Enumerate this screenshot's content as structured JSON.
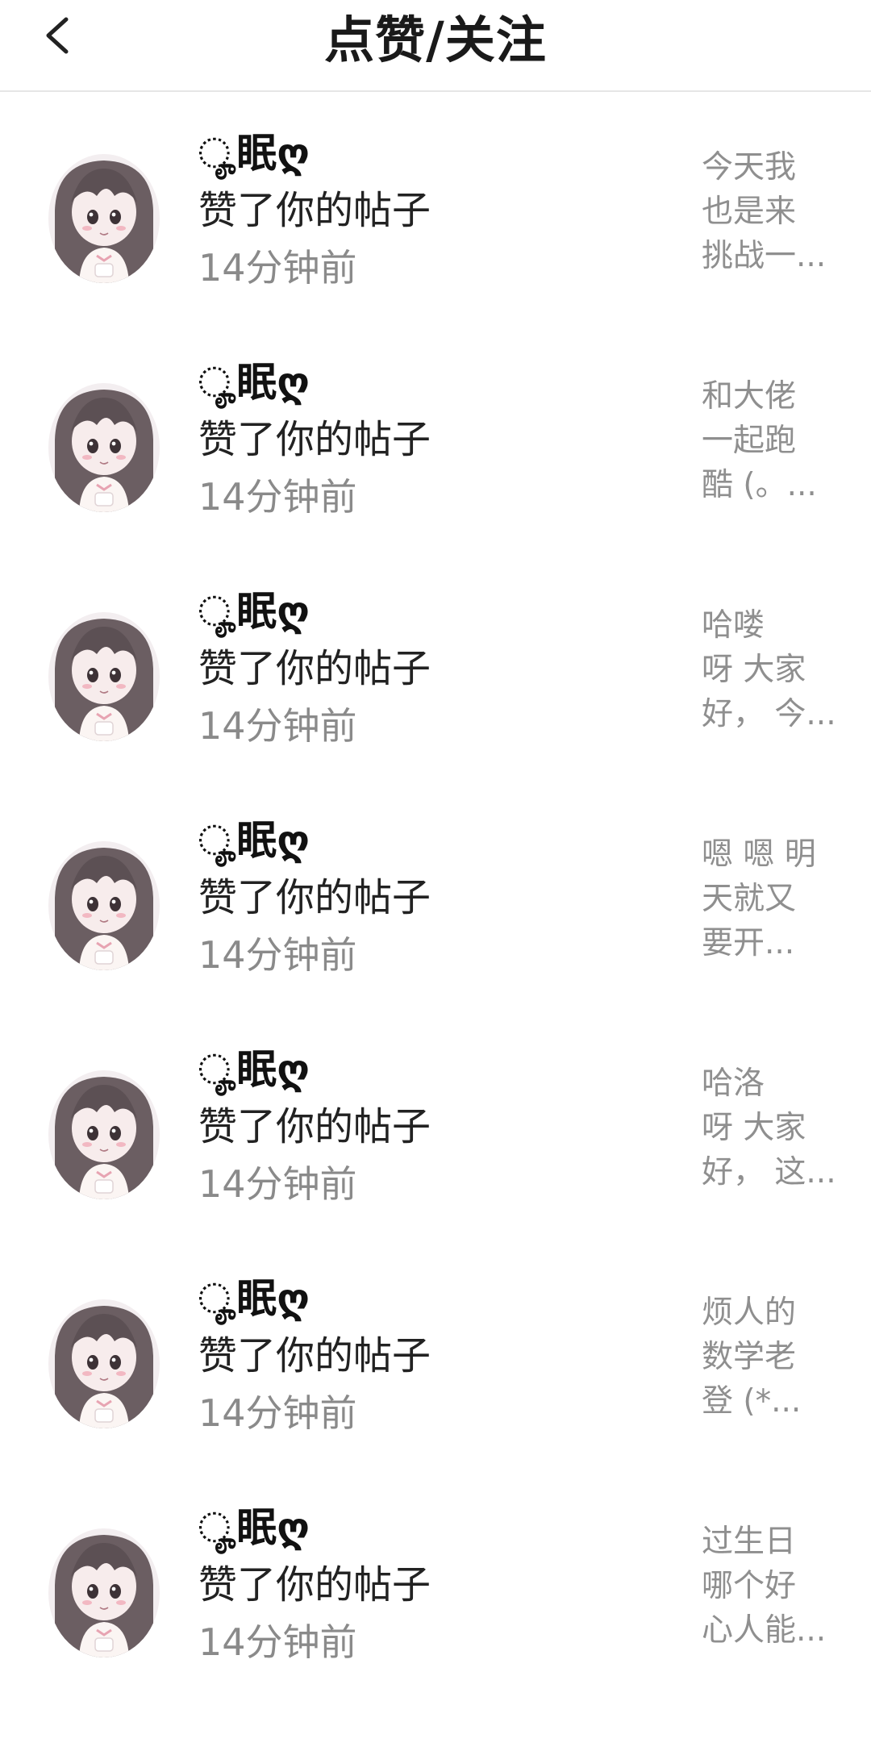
{
  "header": {
    "title": "点赞/关注",
    "back_icon": "chevron-left-icon"
  },
  "items": [
    {
      "user_name": "ೄ眠ღ",
      "action": "赞了你的帖子",
      "time": "14分钟前",
      "preview_lines": [
        "今天我",
        "也是来",
        "挑战一..."
      ]
    },
    {
      "user_name": "ೄ眠ღ",
      "action": "赞了你的帖子",
      "time": "14分钟前",
      "preview_lines": [
        "和大佬",
        "一起跑",
        "酷 (。..."
      ]
    },
    {
      "user_name": "ೄ眠ღ",
      "action": "赞了你的帖子",
      "time": "14分钟前",
      "preview_lines": [
        "哈喽",
        "呀 大家",
        "好， 今..."
      ]
    },
    {
      "user_name": "ೄ眠ღ",
      "action": "赞了你的帖子",
      "time": "14分钟前",
      "preview_lines": [
        "嗯 嗯 明",
        "天就又",
        "要开..."
      ]
    },
    {
      "user_name": "ೄ眠ღ",
      "action": "赞了你的帖子",
      "time": "14分钟前",
      "preview_lines": [
        "哈洛",
        "呀 大家",
        "好， 这..."
      ]
    },
    {
      "user_name": "ೄ眠ღ",
      "action": "赞了你的帖子",
      "time": "14分钟前",
      "preview_lines": [
        "烦人的",
        "数学老",
        "登 (*..."
      ]
    },
    {
      "user_name": "ೄ眠ღ",
      "action": "赞了你的帖子",
      "time": "14分钟前",
      "preview_lines": [
        "过生日",
        "哪个好",
        "心人能..."
      ]
    }
  ]
}
